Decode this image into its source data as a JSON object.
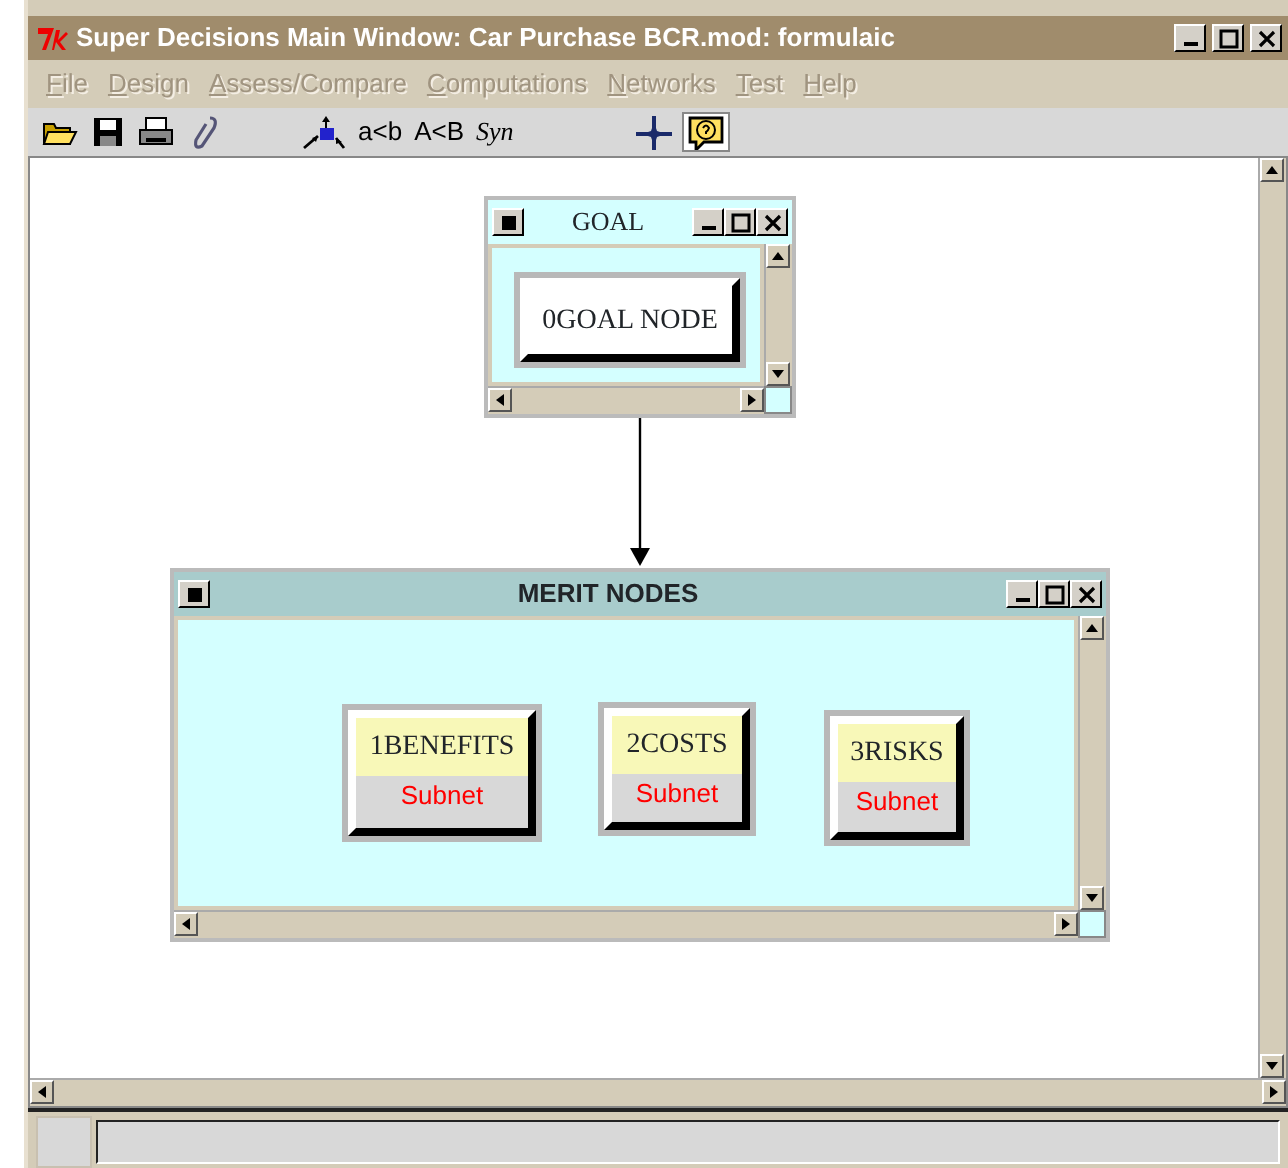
{
  "window": {
    "title": "Super Decisions Main Window: Car Purchase BCR.mod: formulaic"
  },
  "menu": [
    {
      "label": "File"
    },
    {
      "label": "Design"
    },
    {
      "label": "Assess/Compare"
    },
    {
      "label": "Computations"
    },
    {
      "label": "Networks"
    },
    {
      "label": "Test"
    },
    {
      "label": "Help"
    }
  ],
  "toolbar": {
    "text_tools": [
      "a<b",
      "A<B",
      "Syn"
    ],
    "help_pressed": true
  },
  "clusters": [
    {
      "title": "GOAL",
      "active": false,
      "nodes": [
        {
          "label": "0GOAL NODE"
        }
      ]
    },
    {
      "title": "MERIT NODES",
      "active": true,
      "nodes": [
        {
          "label": "1BENEFITS",
          "sublabel": "Subnet"
        },
        {
          "label": "2COSTS",
          "sublabel": "Subnet"
        },
        {
          "label": "3RISKS",
          "sublabel": "Subnet"
        }
      ]
    }
  ]
}
